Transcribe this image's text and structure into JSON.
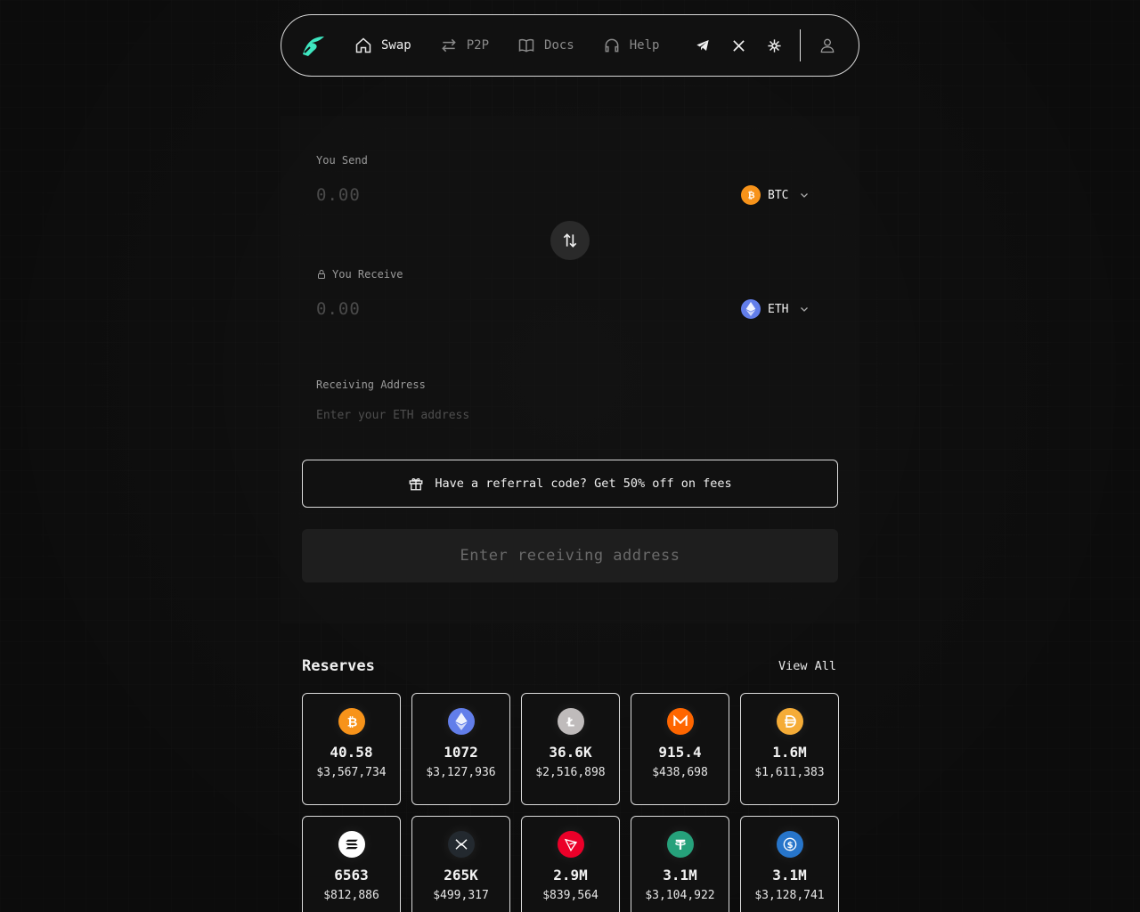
{
  "nav": {
    "items": [
      {
        "label": "Swap",
        "icon": "home-icon",
        "active": true
      },
      {
        "label": "P2P",
        "icon": "arrows-exchange-icon",
        "active": false
      },
      {
        "label": "Docs",
        "icon": "book-icon",
        "active": false
      },
      {
        "label": "Help",
        "icon": "headset-icon",
        "active": false
      }
    ],
    "social": [
      "telegram-icon",
      "x-icon",
      "snowflake-icon"
    ],
    "accent": "#3ee6c0"
  },
  "swap": {
    "send_label": "You Send",
    "send_placeholder": "0.00",
    "send_token": "BTC",
    "receive_label": "You Receive",
    "receive_placeholder": "0.00",
    "receive_token": "ETH",
    "address_label": "Receiving Address",
    "address_placeholder": "Enter your ETH address",
    "referral_text": "Have a referral code? Get 50% off on fees",
    "submit_label": "Enter receiving address"
  },
  "reserves": {
    "title": "Reserves",
    "view_all": "View All",
    "items": [
      {
        "coin": "bitcoin-icon",
        "color": "#f7931a",
        "amount": "40.58",
        "usd": "$3,567,734"
      },
      {
        "coin": "ethereum-icon",
        "color": "#627eea",
        "amount": "1072",
        "usd": "$3,127,936"
      },
      {
        "coin": "litecoin-icon",
        "color": "#bfbbbb",
        "amount": "36.6K",
        "usd": "$2,516,898"
      },
      {
        "coin": "monero-icon",
        "color": "#ff6600",
        "amount": "915.4",
        "usd": "$438,698"
      },
      {
        "coin": "dai-icon",
        "color": "#f5ac37",
        "amount": "1.6M",
        "usd": "$1,611,383"
      },
      {
        "coin": "solana-icon",
        "color": "#ffffff",
        "amount": "6563",
        "usd": "$812,886"
      },
      {
        "coin": "xrp-icon",
        "color": "#23292f",
        "amount": "265K",
        "usd": "$499,317"
      },
      {
        "coin": "tron-icon",
        "color": "#eb0029",
        "amount": "2.9M",
        "usd": "$839,564"
      },
      {
        "coin": "tether-icon",
        "color": "#26a17b",
        "amount": "3.1M",
        "usd": "$3,104,922"
      },
      {
        "coin": "usdc-icon",
        "color": "#2775ca",
        "amount": "3.1M",
        "usd": "$3,128,741"
      }
    ]
  }
}
